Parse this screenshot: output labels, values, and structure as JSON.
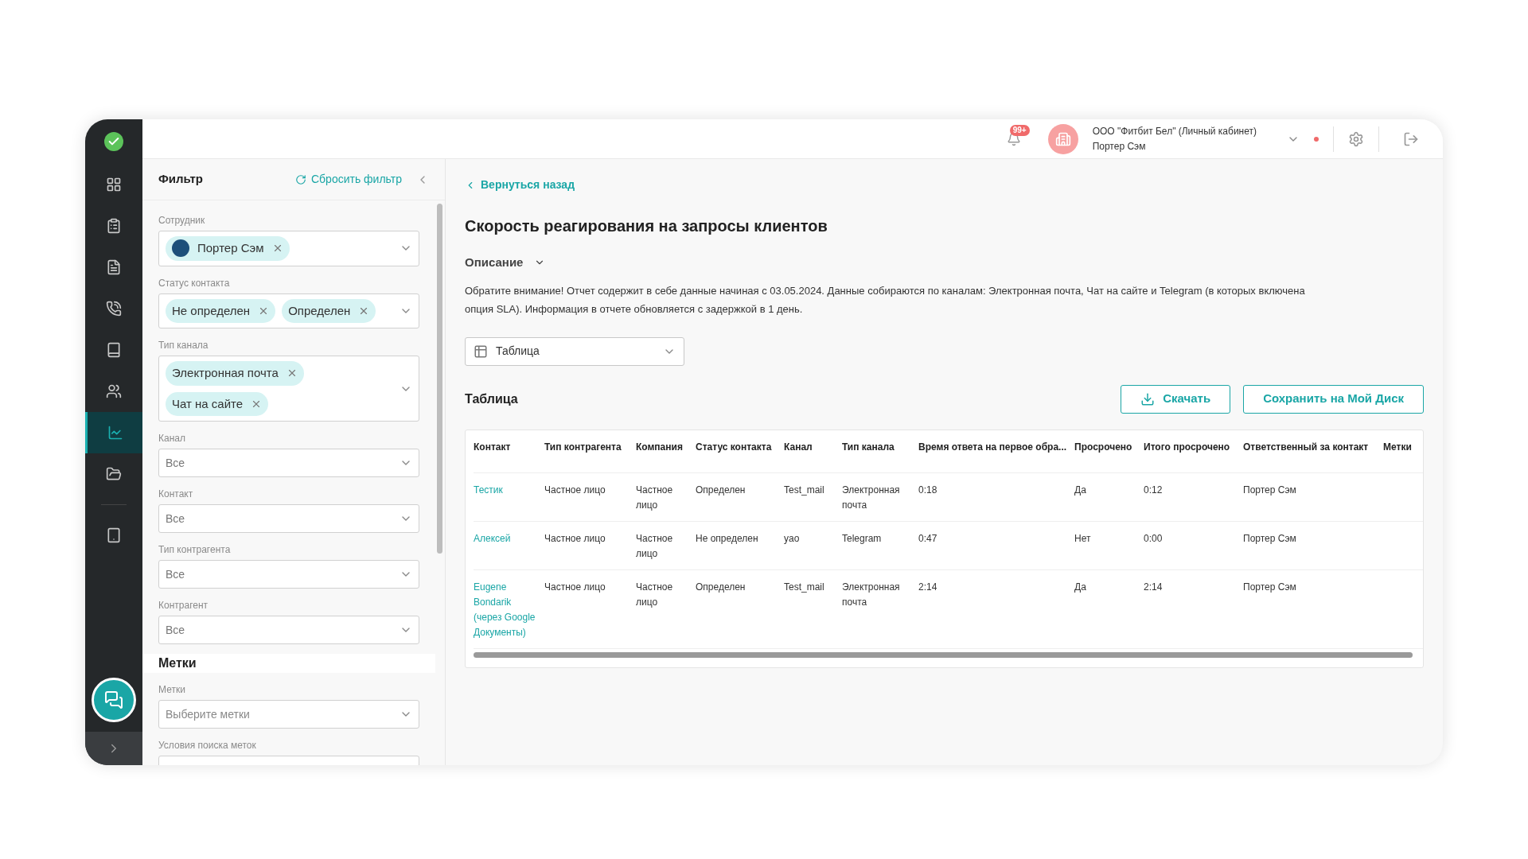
{
  "sidebar": {
    "items": [
      {
        "selected": false
      },
      {
        "selected": false
      },
      {
        "selected": false
      },
      {
        "selected": false
      },
      {
        "selected": false
      },
      {
        "selected": false
      },
      {
        "selected": true
      },
      {
        "selected": false
      },
      {
        "selected": false
      }
    ]
  },
  "header": {
    "notification_badge": "99+",
    "account_name": "ООО \"Фитбит Бел\" (Личный кабинет)",
    "user_name": "Портер Сэм"
  },
  "filter": {
    "title": "Фильтр",
    "reset": "Сбросить фильтр",
    "fields": [
      {
        "kind": "tags",
        "label": "Сотрудник",
        "tags": [
          {
            "text": "Портер Сэм",
            "avatar": true
          }
        ]
      },
      {
        "kind": "tags",
        "label": "Статус контакта",
        "tags": [
          {
            "text": "Не определен",
            "avatar": false
          },
          {
            "text": "Определен",
            "avatar": false
          }
        ]
      },
      {
        "kind": "tags",
        "label": "Тип канала",
        "tags": [
          {
            "text": "Электронная почта",
            "avatar": false
          },
          {
            "text": "Чат на сайте",
            "avatar": false
          }
        ]
      },
      {
        "kind": "select",
        "label": "Канал",
        "value": "Все"
      },
      {
        "kind": "select",
        "label": "Контакт",
        "value": "Все"
      },
      {
        "kind": "select",
        "label": "Тип контрагента",
        "value": "Все"
      },
      {
        "kind": "select",
        "label": "Контрагент",
        "value": "Все"
      }
    ],
    "tags_section": {
      "title": "Метки",
      "fields": [
        {
          "kind": "select",
          "label": "Метки",
          "placeholder": "Выберите метки"
        },
        {
          "kind": "select",
          "label": "Условия поиска меток"
        }
      ]
    }
  },
  "back_link": "Вернуться назад",
  "title": "Скорость реагирования на запросы клиентов",
  "description": {
    "toggle": "Описание",
    "text": "Обратите внимание! Отчет содержит в себе данные начиная с 03.05.2024. Данные собираются по каналам: Электронная почта, Чат на сайте и Telegram (в которых включена опция SLA). Информация в отчете обновляется с задержкой в 1 день."
  },
  "view_select": "Таблица",
  "table_title": "Таблица",
  "buttons": {
    "download": "Скачать",
    "save": "Сохранить на Мой Диск"
  },
  "table": {
    "columns": [
      "Контакт",
      "Тип контрагента",
      "Компания",
      "Статус контакта",
      "Канал",
      "Тип канала",
      "Время ответа на первое обра...",
      "Просрочено",
      "Итого просрочено",
      "Ответственный за контакт",
      "Метки"
    ],
    "rows": [
      [
        "Тестик",
        "Частное лицо",
        "Частное лицо",
        "Определен",
        "Test_mail",
        "Электронная почта",
        "0:18",
        "Да",
        "0:12",
        "Портер Сэм"
      ],
      [
        "Алексей",
        "Частное лицо",
        "Частное лицо",
        "Не определен",
        "yao",
        "Telegram",
        "0:47",
        "Нет",
        "0:00",
        "Портер Сэм"
      ],
      [
        "Eugene Bondarik (через Google Документы)",
        "Частное лицо",
        "Частное лицо",
        "Определен",
        "Test_mail",
        "Электронная почта",
        "2:14",
        "Да",
        "2:14",
        "Портер Сэм"
      ]
    ]
  }
}
